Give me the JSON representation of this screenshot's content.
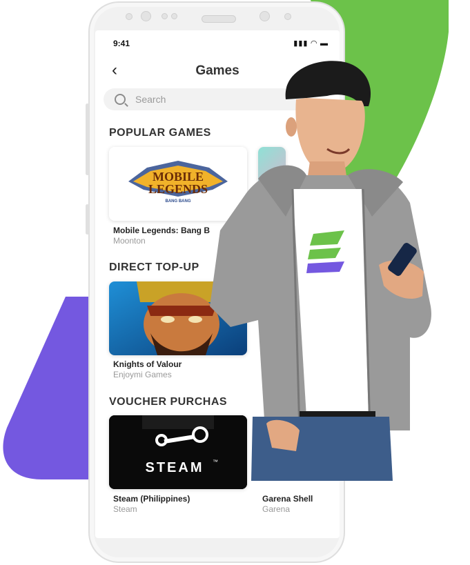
{
  "status_bar": {
    "time": "9:41",
    "icons": "▮▮▮ ◠ ▬"
  },
  "header": {
    "back": "‹",
    "title": "Games"
  },
  "search": {
    "placeholder": "Search"
  },
  "sections": {
    "popular": {
      "title": "POPULAR GAMES",
      "items": [
        {
          "name": "Mobile Legends: Bang B",
          "publisher": "Moonton",
          "logo_line1": "MOBILE",
          "logo_line2": "LEGENDS",
          "logo_line3": "BANG BANG"
        }
      ]
    },
    "direct": {
      "title": "DIRECT TOP-UP",
      "items": [
        {
          "name": "Knights of Valour",
          "publisher": "Enjoymi Games"
        }
      ]
    },
    "voucher": {
      "title": "VOUCHER PURCHAS",
      "items": [
        {
          "name": "Steam (Philippines)",
          "publisher": "Steam",
          "logo_text": "STEAM",
          "logo_tm": "™"
        },
        {
          "name": "Garena Shell",
          "publisher": "Garena"
        }
      ]
    }
  },
  "colors": {
    "green": "#6cc24a",
    "purple": "#7458e0",
    "text": "#333333",
    "muted": "#999999"
  }
}
